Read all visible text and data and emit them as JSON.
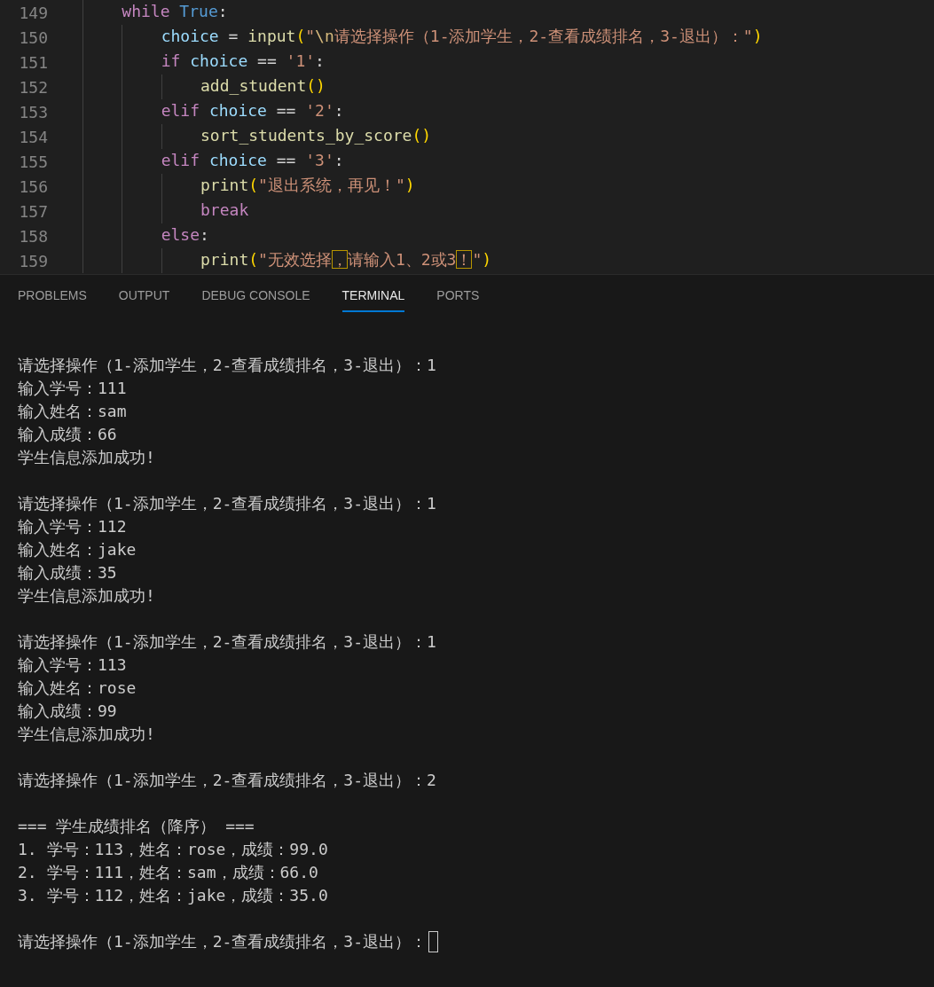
{
  "editor": {
    "lines": [
      {
        "number": "149",
        "tokens": [
          {
            "kind": "keyword",
            "text": "while"
          },
          {
            "kind": "constant",
            "text": " True"
          },
          {
            "kind": "plain",
            "text": ":"
          }
        ],
        "children": [
          {
            "number": "150",
            "tokens": [
              {
                "kind": "variable",
                "text": "choice"
              },
              {
                "kind": "plain",
                "text": " = "
              },
              {
                "kind": "function",
                "text": "input"
              },
              {
                "kind": "bracket",
                "text": "("
              },
              {
                "kind": "string",
                "text": "\""
              },
              {
                "kind": "escape",
                "text": "\\n"
              },
              {
                "kind": "string",
                "text": "请选择操作（1-添加学生，2-查看成绩排名，3-退出）：\""
              },
              {
                "kind": "bracket",
                "text": ")"
              }
            ]
          },
          {
            "number": "151",
            "tokens": [
              {
                "kind": "keyword",
                "text": "if"
              },
              {
                "kind": "variable",
                "text": " choice"
              },
              {
                "kind": "plain",
                "text": " == "
              },
              {
                "kind": "string",
                "text": "'1'"
              },
              {
                "kind": "plain",
                "text": ":"
              }
            ],
            "children": [
              {
                "number": "152",
                "tokens": [
                  {
                    "kind": "function",
                    "text": "add_student"
                  },
                  {
                    "kind": "bracket",
                    "text": "()"
                  }
                ]
              }
            ]
          },
          {
            "number": "153",
            "tokens": [
              {
                "kind": "keyword",
                "text": "elif"
              },
              {
                "kind": "variable",
                "text": " choice"
              },
              {
                "kind": "plain",
                "text": " == "
              },
              {
                "kind": "string",
                "text": "'2'"
              },
              {
                "kind": "plain",
                "text": ":"
              }
            ],
            "children": [
              {
                "number": "154",
                "tokens": [
                  {
                    "kind": "function",
                    "text": "sort_students_by_score"
                  },
                  {
                    "kind": "bracket",
                    "text": "()"
                  }
                ]
              }
            ]
          },
          {
            "number": "155",
            "tokens": [
              {
                "kind": "keyword",
                "text": "elif"
              },
              {
                "kind": "variable",
                "text": " choice"
              },
              {
                "kind": "plain",
                "text": " == "
              },
              {
                "kind": "string",
                "text": "'3'"
              },
              {
                "kind": "plain",
                "text": ":"
              }
            ],
            "children": [
              {
                "number": "156",
                "tokens": [
                  {
                    "kind": "function",
                    "text": "print"
                  },
                  {
                    "kind": "bracket",
                    "text": "("
                  },
                  {
                    "kind": "string",
                    "text": "\"退出系统，再见！\""
                  },
                  {
                    "kind": "bracket",
                    "text": ")"
                  }
                ]
              },
              {
                "number": "157",
                "tokens": [
                  {
                    "kind": "keyword",
                    "text": "break"
                  }
                ]
              }
            ]
          },
          {
            "number": "158",
            "tokens": [
              {
                "kind": "keyword",
                "text": "else"
              },
              {
                "kind": "plain",
                "text": ":"
              }
            ],
            "children": [
              {
                "number": "159",
                "tokens": [
                  {
                    "kind": "function",
                    "text": "print"
                  },
                  {
                    "kind": "bracket",
                    "text": "("
                  },
                  {
                    "kind": "string",
                    "text": "\"无效选择"
                  },
                  {
                    "kind": "flagged",
                    "text": "，"
                  },
                  {
                    "kind": "string",
                    "text": "请输入1、2或3"
                  },
                  {
                    "kind": "flagged",
                    "text": "！"
                  },
                  {
                    "kind": "string",
                    "text": "\""
                  },
                  {
                    "kind": "bracket",
                    "text": ")"
                  }
                ]
              }
            ]
          }
        ]
      }
    ]
  },
  "panel": {
    "tabs": [
      {
        "label": "PROBLEMS",
        "selected": false
      },
      {
        "label": "OUTPUT",
        "selected": false
      },
      {
        "label": "DEBUG CONSOLE",
        "selected": false
      },
      {
        "label": "TERMINAL",
        "selected": true
      },
      {
        "label": "PORTS",
        "selected": false
      }
    ]
  },
  "terminal": {
    "blocks": [
      [
        "请选择操作（1-添加学生，2-查看成绩排名，3-退出）：1",
        "输入学号：111",
        "输入姓名：sam",
        "输入成绩：66",
        "学生信息添加成功!"
      ],
      [
        "请选择操作（1-添加学生，2-查看成绩排名，3-退出）：1",
        "输入学号：112",
        "输入姓名：jake",
        "输入成绩：35",
        "学生信息添加成功!"
      ],
      [
        "请选择操作（1-添加学生，2-查看成绩排名，3-退出）：1",
        "输入学号：113",
        "输入姓名：rose",
        "输入成绩：99",
        "学生信息添加成功!"
      ],
      [
        "请选择操作（1-添加学生，2-查看成绩排名，3-退出）：2"
      ],
      [
        "=== 学生成绩排名（降序） ===",
        "1. 学号：113，姓名：rose，成绩：99.0",
        "2. 学号：111，姓名：sam，成绩：66.0",
        "3. 学号：112，姓名：jake，成绩：35.0"
      ],
      [
        "请选择操作（1-添加学生，2-查看成绩排名，3-退出）："
      ]
    ],
    "cursor": true
  }
}
